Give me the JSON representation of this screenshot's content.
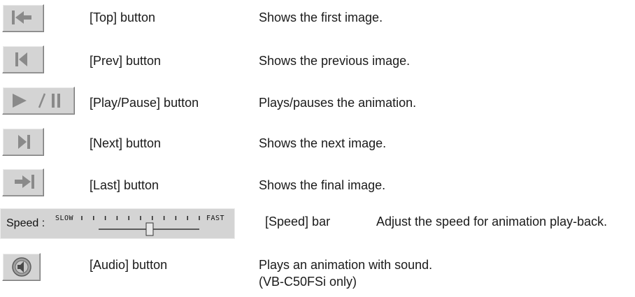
{
  "rows": [
    {
      "label": "[Top] button",
      "desc": "Shows the first image.",
      "icon": "skip-to-first-icon"
    },
    {
      "label": "[Prev] button",
      "desc": "Shows the previous image.",
      "icon": "previous-frame-icon"
    },
    {
      "label": "[Play/Pause] button",
      "desc": "Plays/pauses the animation.",
      "icon": "play-pause-icon"
    },
    {
      "label": "[Next] button",
      "desc": "Shows the next image.",
      "icon": "next-frame-icon"
    },
    {
      "label": "[Last] button",
      "desc": "Shows the final image.",
      "icon": "skip-to-last-icon"
    }
  ],
  "speed": {
    "panel_label": "Speed :",
    "slow_label": "SLOW",
    "fast_label": "FAST",
    "label": "[Speed] bar",
    "desc": "Adjust the speed for animation play-back.",
    "value": 0.5
  },
  "audio": {
    "label": "[Audio] button",
    "desc_line1": "Plays an animation with sound.",
    "desc_line2": "(VB-C50FSi only)",
    "icon": "speaker-icon"
  },
  "colors": {
    "button_face": "#d4d4d4",
    "icon_gray": "#8a8a8a",
    "text": "#1a1a1a"
  }
}
